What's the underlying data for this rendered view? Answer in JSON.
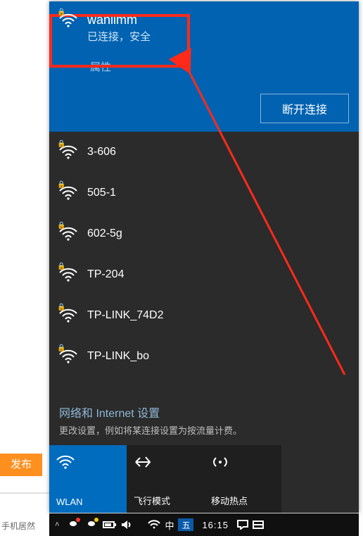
{
  "background": {
    "publish_button": "发布",
    "bottom_teaser": "手机居然"
  },
  "connected": {
    "ssid": "wanlimm",
    "status": "已连接，安全",
    "properties_label": "属性",
    "disconnect_label": "断开连接"
  },
  "networks": [
    {
      "ssid": "3-606",
      "secured": true
    },
    {
      "ssid": "505-1",
      "secured": true
    },
    {
      "ssid": "602-5g",
      "secured": true
    },
    {
      "ssid": "TP-204",
      "secured": true
    },
    {
      "ssid": "TP-LINK_74D2",
      "secured": true
    },
    {
      "ssid": "TP-LINK_bo",
      "secured": true
    }
  ],
  "settings": {
    "title": "网络和 Internet 设置",
    "subtitle": "更改设置，例如将某连接设置为按流量计费。"
  },
  "tiles": {
    "wlan": "WLAN",
    "airplane": "飞行模式",
    "hotspot": "移动热点"
  },
  "taskbar": {
    "ime1": "中",
    "ime2": "五",
    "time": "16:15"
  }
}
